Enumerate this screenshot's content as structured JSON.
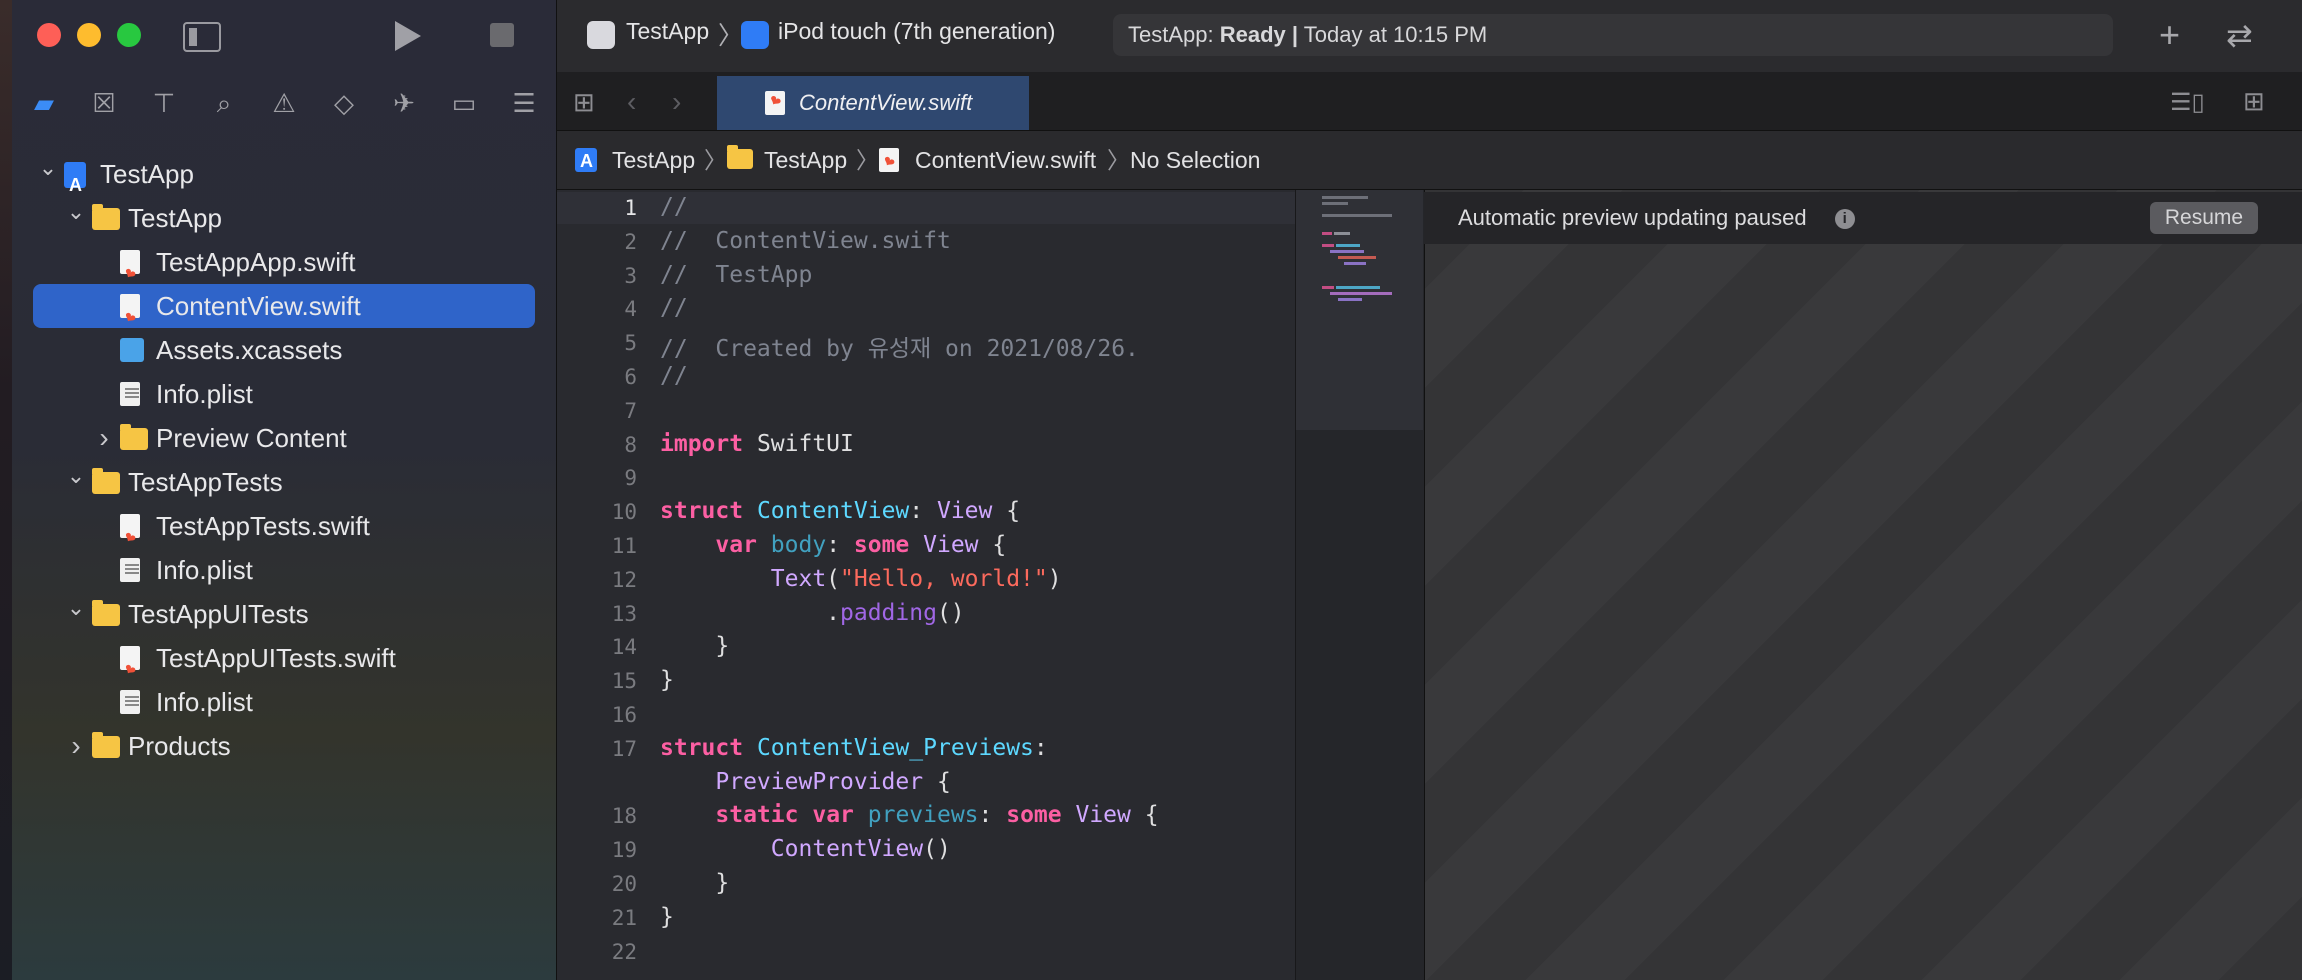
{
  "toolbar": {
    "scheme": "TestApp",
    "destination": "iPod touch (7th generation)",
    "status_app": "TestApp:",
    "status_state": "Ready",
    "status_sep": "|",
    "status_time": "Today at 10:15 PM",
    "add_symbol": "+",
    "swap_symbol": "⇄"
  },
  "tabs": [
    {
      "label": "ContentView.swift",
      "active": true
    }
  ],
  "breadcrumb": [
    "TestApp",
    "TestApp",
    "ContentView.swift",
    "No Selection"
  ],
  "navigator": {
    "items": [
      {
        "label": "TestApp",
        "kind": "project",
        "depth": 0,
        "expanded": true
      },
      {
        "label": "TestApp",
        "kind": "folder",
        "depth": 1,
        "expanded": true
      },
      {
        "label": "TestAppApp.swift",
        "kind": "swift",
        "depth": 2
      },
      {
        "label": "ContentView.swift",
        "kind": "swift",
        "depth": 2,
        "selected": true
      },
      {
        "label": "Assets.xcassets",
        "kind": "assets",
        "depth": 2
      },
      {
        "label": "Info.plist",
        "kind": "plist",
        "depth": 2
      },
      {
        "label": "Preview Content",
        "kind": "folder",
        "depth": 2,
        "expanded": false
      },
      {
        "label": "TestAppTests",
        "kind": "folder",
        "depth": 1,
        "expanded": true
      },
      {
        "label": "TestAppTests.swift",
        "kind": "swift",
        "depth": 2
      },
      {
        "label": "Info.plist",
        "kind": "plist",
        "depth": 2
      },
      {
        "label": "TestAppUITests",
        "kind": "folder",
        "depth": 1,
        "expanded": true
      },
      {
        "label": "TestAppUITests.swift",
        "kind": "swift",
        "depth": 2
      },
      {
        "label": "Info.plist",
        "kind": "plist",
        "depth": 2
      },
      {
        "label": "Products",
        "kind": "folder",
        "depth": 1,
        "expanded": false
      }
    ]
  },
  "editor": {
    "current_line": 1,
    "lines": [
      {
        "n": "1",
        "tokens": [
          {
            "t": "//",
            "c": "cmt"
          }
        ]
      },
      {
        "n": "2",
        "tokens": [
          {
            "t": "//  ContentView.swift",
            "c": "cmt"
          }
        ]
      },
      {
        "n": "3",
        "tokens": [
          {
            "t": "//  TestApp",
            "c": "cmt"
          }
        ]
      },
      {
        "n": "4",
        "tokens": [
          {
            "t": "//",
            "c": "cmt"
          }
        ]
      },
      {
        "n": "5",
        "tokens": [
          {
            "t": "//  Created by 유성재 on 2021/08/26.",
            "c": "cmt"
          }
        ]
      },
      {
        "n": "6",
        "tokens": [
          {
            "t": "//",
            "c": "cmt"
          }
        ]
      },
      {
        "n": "7",
        "tokens": []
      },
      {
        "n": "8",
        "tokens": [
          {
            "t": "import",
            "c": "kw"
          },
          {
            "t": " SwiftUI",
            "c": ""
          }
        ]
      },
      {
        "n": "9",
        "tokens": []
      },
      {
        "n": "10",
        "tokens": [
          {
            "t": "struct",
            "c": "kw"
          },
          {
            "t": " ",
            "c": ""
          },
          {
            "t": "ContentView",
            "c": "ty"
          },
          {
            "t": ": ",
            "c": ""
          },
          {
            "t": "View",
            "c": "ty2"
          },
          {
            "t": " {",
            "c": ""
          }
        ]
      },
      {
        "n": "11",
        "tokens": [
          {
            "t": "    ",
            "c": ""
          },
          {
            "t": "var",
            "c": "kw"
          },
          {
            "t": " ",
            "c": ""
          },
          {
            "t": "body",
            "c": "prop"
          },
          {
            "t": ": ",
            "c": ""
          },
          {
            "t": "some",
            "c": "kw"
          },
          {
            "t": " ",
            "c": ""
          },
          {
            "t": "View",
            "c": "ty2"
          },
          {
            "t": " {",
            "c": ""
          }
        ]
      },
      {
        "n": "12",
        "tokens": [
          {
            "t": "        ",
            "c": ""
          },
          {
            "t": "Text",
            "c": "ty2"
          },
          {
            "t": "(",
            "c": ""
          },
          {
            "t": "\"Hello, world!\"",
            "c": "str"
          },
          {
            "t": ")",
            "c": ""
          }
        ]
      },
      {
        "n": "13",
        "tokens": [
          {
            "t": "            .",
            "c": ""
          },
          {
            "t": "padding",
            "c": "fn"
          },
          {
            "t": "()",
            "c": ""
          }
        ]
      },
      {
        "n": "14",
        "tokens": [
          {
            "t": "    }",
            "c": ""
          }
        ]
      },
      {
        "n": "15",
        "tokens": [
          {
            "t": "}",
            "c": ""
          }
        ]
      },
      {
        "n": "16",
        "tokens": []
      },
      {
        "n": "17",
        "tokens": [
          {
            "t": "struct",
            "c": "kw"
          },
          {
            "t": " ",
            "c": ""
          },
          {
            "t": "ContentView_Previews",
            "c": "ty"
          },
          {
            "t": ":",
            "c": ""
          }
        ]
      },
      {
        "n": "",
        "tokens": [
          {
            "t": "    ",
            "c": ""
          },
          {
            "t": "PreviewProvider",
            "c": "ty2"
          },
          {
            "t": " {",
            "c": ""
          }
        ]
      },
      {
        "n": "18",
        "tokens": [
          {
            "t": "    ",
            "c": ""
          },
          {
            "t": "static",
            "c": "kw"
          },
          {
            "t": " ",
            "c": ""
          },
          {
            "t": "var",
            "c": "kw"
          },
          {
            "t": " ",
            "c": ""
          },
          {
            "t": "previews",
            "c": "prop"
          },
          {
            "t": ": ",
            "c": ""
          },
          {
            "t": "some",
            "c": "kw"
          },
          {
            "t": " ",
            "c": ""
          },
          {
            "t": "View",
            "c": "ty2"
          },
          {
            "t": " {",
            "c": ""
          }
        ]
      },
      {
        "n": "19",
        "tokens": [
          {
            "t": "        ",
            "c": ""
          },
          {
            "t": "ContentView",
            "c": "ty2"
          },
          {
            "t": "()",
            "c": ""
          }
        ]
      },
      {
        "n": "20",
        "tokens": [
          {
            "t": "    }",
            "c": ""
          }
        ]
      },
      {
        "n": "21",
        "tokens": [
          {
            "t": "}",
            "c": ""
          }
        ]
      },
      {
        "n": "22",
        "tokens": []
      }
    ]
  },
  "preview": {
    "message": "Automatic preview updating paused",
    "info_symbol": "i",
    "resume_label": "Resume"
  },
  "colors": {
    "selection": "#2f64c9",
    "keyword": "#fc5fa3",
    "type": "#5dd8ff",
    "string": "#fc6a5d",
    "comment": "#7f8490"
  }
}
